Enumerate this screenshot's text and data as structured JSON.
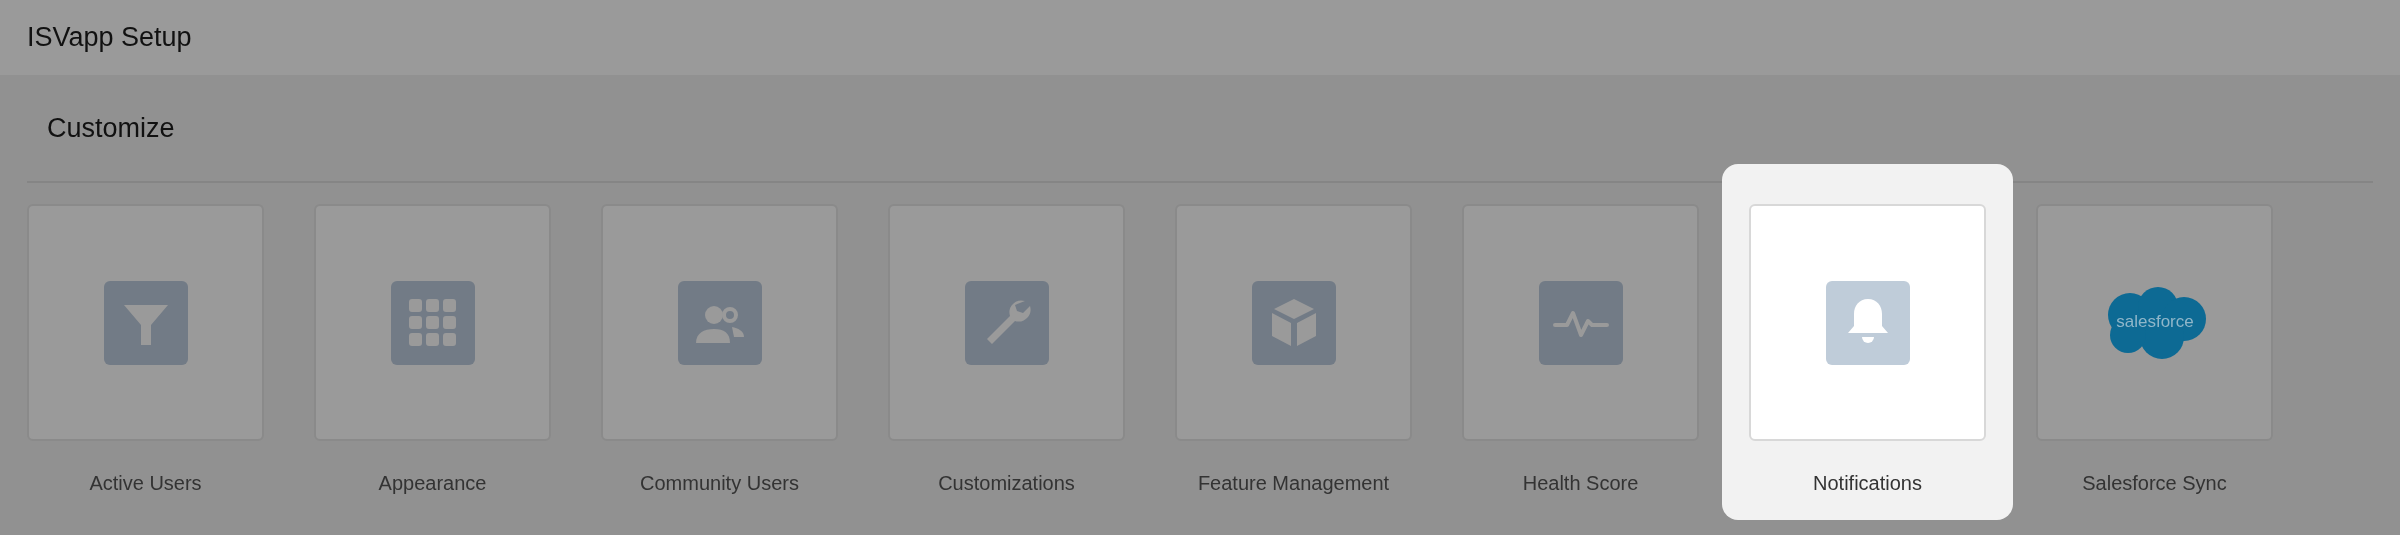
{
  "header": {
    "title": "ISVapp Setup"
  },
  "section": {
    "title": "Customize"
  },
  "tiles": [
    {
      "label": "Active Users",
      "kind": "funnel",
      "selected": false
    },
    {
      "label": "Appearance",
      "kind": "grid",
      "selected": false
    },
    {
      "label": "Community Users",
      "kind": "people",
      "selected": false
    },
    {
      "label": "Customizations",
      "kind": "wrench",
      "selected": false
    },
    {
      "label": "Feature Management",
      "kind": "cube",
      "selected": false
    },
    {
      "label": "Health Score",
      "kind": "pulse",
      "selected": false
    },
    {
      "label": "Notifications",
      "kind": "bell",
      "selected": true
    },
    {
      "label": "Salesforce Sync",
      "kind": "logo",
      "logo_text": "salesforce",
      "selected": false
    }
  ]
}
